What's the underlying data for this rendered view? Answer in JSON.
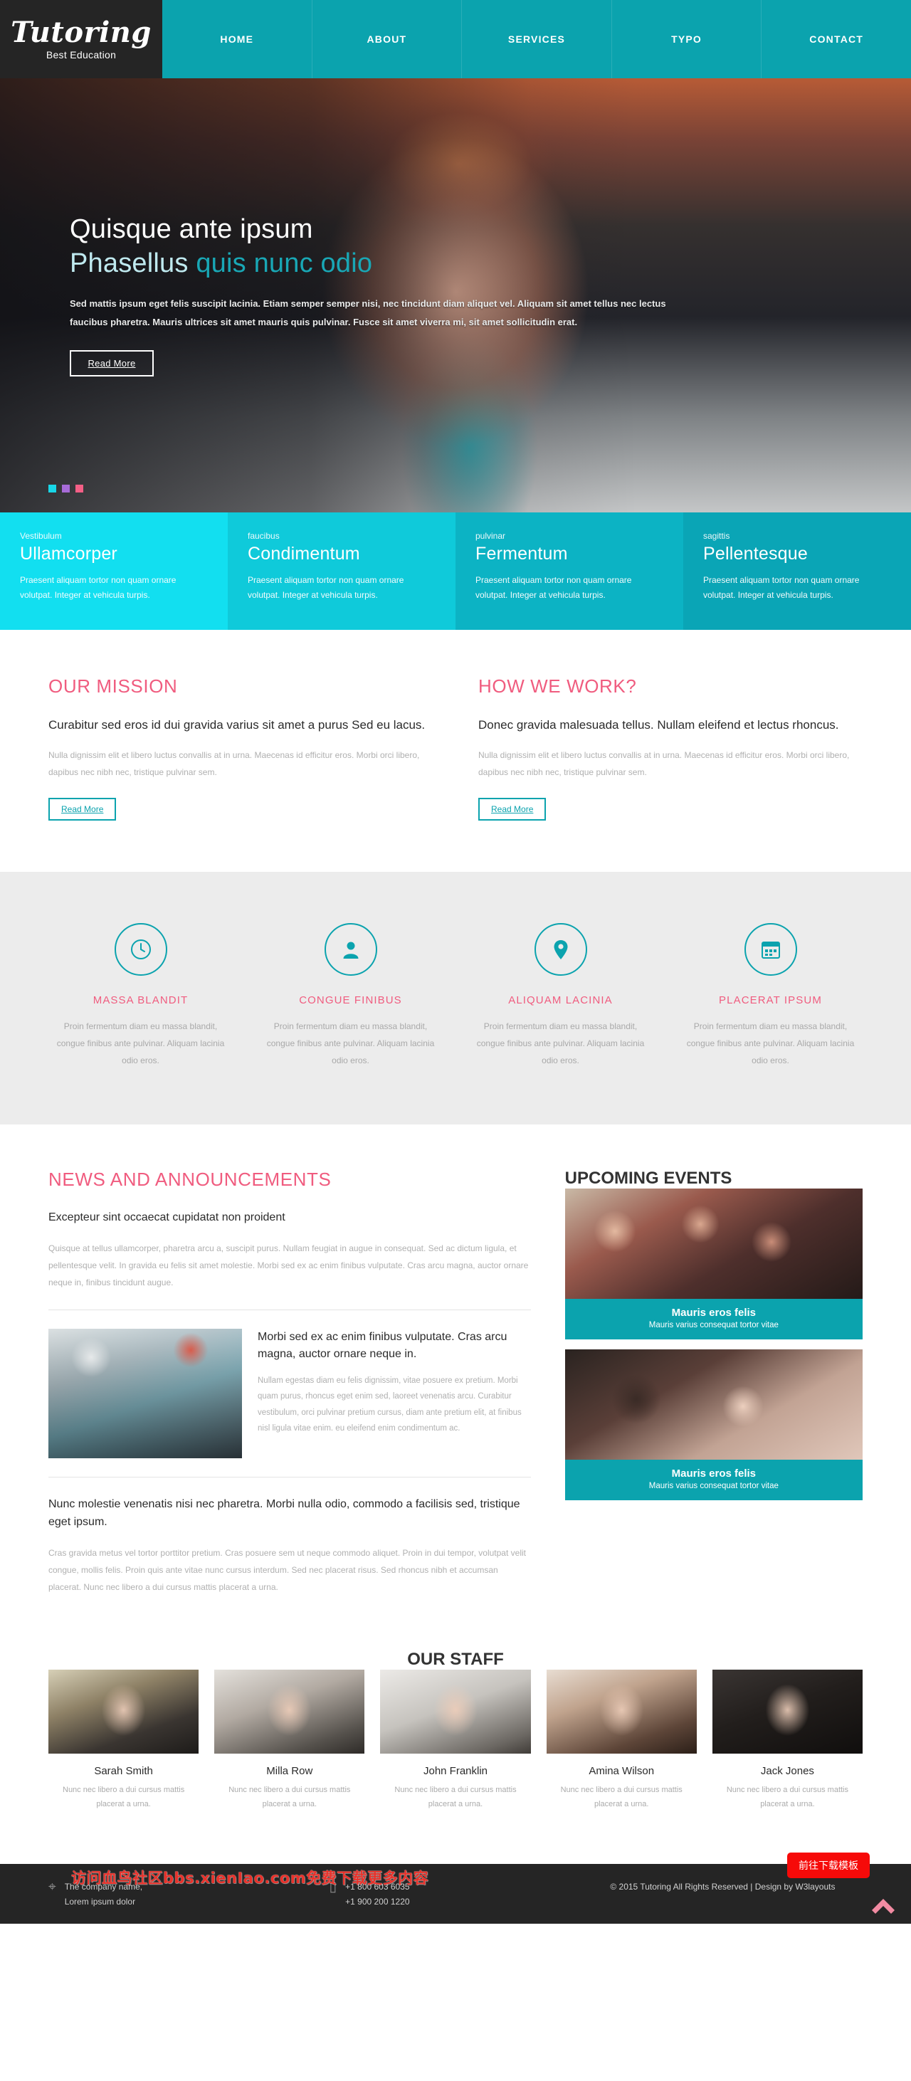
{
  "brand": {
    "name": "Tutoring",
    "tagline": "Best Education"
  },
  "nav": {
    "items": [
      "HOME",
      "ABOUT",
      "SERVICES",
      "TYPO",
      "CONTACT"
    ]
  },
  "hero": {
    "line1": "Quisque ante ipsum",
    "line2_lead": "Phasellus",
    "line2_rest": " quis nunc odio",
    "paragraph": "Sed mattis ipsum eget felis suscipit lacinia. Etiam semper semper nisi, nec tincidunt diam aliquet vel. Aliquam sit amet tellus nec lectus faucibus pharetra. Mauris ultrices sit amet mauris quis pulvinar. Fusce sit amet viverra mi, sit amet sollicitudin erat.",
    "button": "Read More"
  },
  "features": [
    {
      "tag": "Vestibulum",
      "title": "Ullamcorper",
      "text": "Praesent aliquam tortor non quam ornare volutpat. Integer at vehicula turpis.",
      "color": "#12dff0"
    },
    {
      "tag": "faucibus",
      "title": "Condimentum",
      "text": "Praesent aliquam tortor non quam ornare volutpat. Integer at vehicula turpis.",
      "color": "#0fcada"
    },
    {
      "tag": "pulvinar",
      "title": "Fermentum",
      "text": "Praesent aliquam tortor non quam ornare volutpat. Integer at vehicula turpis.",
      "color": "#0cb3c4"
    },
    {
      "tag": "sagittis",
      "title": "Pellentesque",
      "text": "Praesent aliquam tortor non quam ornare volutpat. Integer at vehicula turpis.",
      "color": "#0aa5b6"
    }
  ],
  "mission": {
    "title": "OUR MISSION",
    "heading": "Curabitur sed eros id dui gravida varius sit amet a purus Sed eu lacus.",
    "text": "Nulla dignissim elit et libero luctus convallis at in urna. Maecenas id efficitur eros. Morbi orci libero, dapibus nec nibh nec, tristique pulvinar sem.",
    "button": "Read More"
  },
  "how_we_work": {
    "title": "HOW WE WORK?",
    "heading": "Donec gravida malesuada tellus. Nullam eleifend et lectus rhoncus.",
    "text": "Nulla dignissim elit et libero luctus convallis at in urna. Maecenas id efficitur eros. Morbi orci libero, dapibus nec nibh nec, tristique pulvinar sem.",
    "button": "Read More"
  },
  "services": [
    {
      "icon": "clock-icon",
      "title": "MASSA BLANDIT",
      "text": "Proin fermentum diam eu massa blandit, congue finibus ante pulvinar. Aliquam lacinia odio eros."
    },
    {
      "icon": "user-icon",
      "title": "CONGUE FINIBUS",
      "text": "Proin fermentum diam eu massa blandit, congue finibus ante pulvinar. Aliquam lacinia odio eros."
    },
    {
      "icon": "location-icon",
      "title": "ALIQUAM LACINIA",
      "text": "Proin fermentum diam eu massa blandit, congue finibus ante pulvinar. Aliquam lacinia odio eros."
    },
    {
      "icon": "calendar-icon",
      "title": "PLACERAT IPSUM",
      "text": "Proin fermentum diam eu massa blandit, congue finibus ante pulvinar. Aliquam lacinia odio eros."
    }
  ],
  "news": {
    "title": "NEWS AND ANNOUNCEMENTS",
    "lead_heading": "Excepteur sint occaecat cupidatat non proident",
    "lead_text": "Quisque at tellus ullamcorper, pharetra arcu a, suscipit purus. Nullam feugiat in augue in consequat. Sed ac dictum ligula, et pellentesque velit. In gravida eu felis sit amet molestie. Morbi sed ex ac enim finibus vulputate. Cras arcu magna, auctor ornare neque in, finibus tincidunt augue.",
    "item_heading": "Morbi sed ex ac enim finibus vulputate. Cras arcu magna, auctor ornare neque in.",
    "item_text": "Nullam egestas diam eu felis dignissim, vitae posuere ex pretium. Morbi quam purus, rhoncus eget enim sed, laoreet venenatis arcu. Curabitur vestibulum, orci pulvinar pretium cursus, diam ante pretium elit, at finibus nisl ligula vitae enim. eu eleifend enim condimentum ac.",
    "bottom_heading": "Nunc molestie venenatis nisi nec pharetra. Morbi nulla odio, commodo a facilisis sed, tristique eget ipsum.",
    "bottom_text": "Cras gravida metus vel tortor porttitor pretium. Cras posuere sem ut neque commodo aliquet. Proin in dui tempor, volutpat velit congue, mollis felis. Proin quis ante vitae nunc cursus interdum. Sed nec placerat risus. Sed rhoncus nibh et accumsan placerat. Nunc nec libero a dui cursus mattis placerat a urna."
  },
  "events": {
    "title": "UPCOMING EVENTS",
    "items": [
      {
        "title": "Mauris eros felis",
        "subtitle": "Mauris varius consequat tortor vitae"
      },
      {
        "title": "Mauris eros felis",
        "subtitle": "Mauris varius consequat tortor vitae"
      }
    ]
  },
  "staff": {
    "title": "OUR STAFF",
    "members": [
      {
        "name": "Sarah Smith",
        "desc": "Nunc nec libero a dui cursus mattis placerat a urna."
      },
      {
        "name": "Milla Row",
        "desc": "Nunc nec libero a dui cursus mattis placerat a urna."
      },
      {
        "name": "John Franklin",
        "desc": "Nunc nec libero a dui cursus mattis placerat a urna."
      },
      {
        "name": "Amina Wilson",
        "desc": "Nunc nec libero a dui cursus mattis placerat a urna."
      },
      {
        "name": "Jack Jones",
        "desc": "Nunc nec libero a dui cursus mattis placerat a urna."
      }
    ]
  },
  "footer": {
    "address_line1": "The company name,",
    "address_line2": "Lorem ipsum dolor",
    "phone1": "+1 800 603 6035",
    "phone2": "+1 900 200 1220",
    "copyright": "© 2015 Tutoring All Rights Reserved | Design by W3layouts",
    "watermark": "访问血鸟社区bbs.xienIao.com免费下载更多内容",
    "download_button": "前往下载模板"
  },
  "colors": {
    "teal": "#0ba3ae",
    "pink": "#f05c7f",
    "cyan": "#12dff0",
    "dark": "#252525",
    "red": "#f60a09"
  }
}
